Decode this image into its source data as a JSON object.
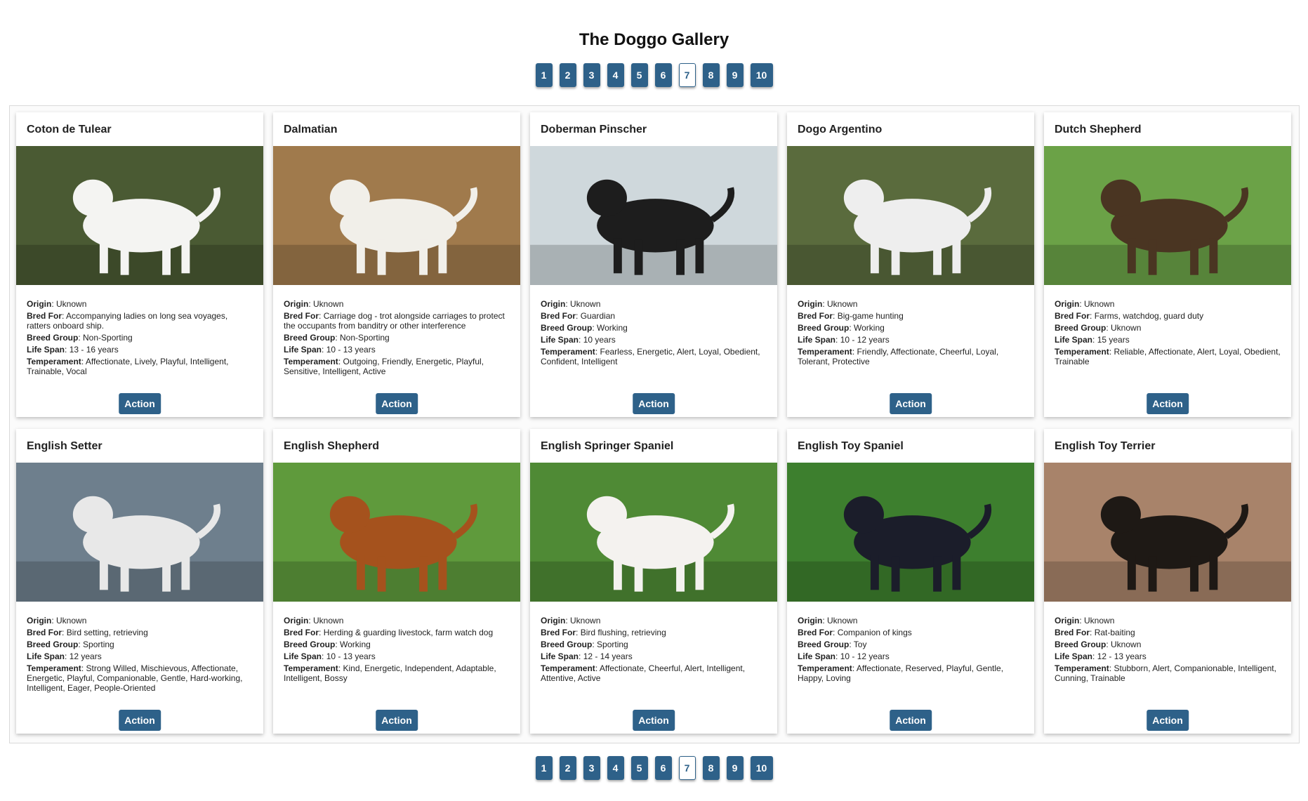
{
  "page": {
    "title": "The Doggo Gallery"
  },
  "pagination": {
    "pages": [
      "1",
      "2",
      "3",
      "4",
      "5",
      "6",
      "7",
      "8",
      "9",
      "10"
    ],
    "current": "7"
  },
  "labels": {
    "origin": "Origin",
    "bred_for": "Bred For",
    "breed_group": "Breed Group",
    "life_span": "Life Span",
    "temperament": "Temperament",
    "action": "Action"
  },
  "colors": {
    "accent": "#2e6189"
  },
  "breeds": [
    {
      "name": "Coton de Tulear",
      "origin": "Uknown",
      "bred_for": "Accompanying ladies on long sea voyages, ratters onboard ship.",
      "breed_group": "Non-Sporting",
      "life_span": "13 - 16 years",
      "temperament": "Affectionate, Lively, Playful, Intelligent, Trainable, Vocal",
      "photo": "white fluffy dog on garden path",
      "bg": "#4a5a33",
      "fg": "#f4f4f2"
    },
    {
      "name": "Dalmatian",
      "origin": "Uknown",
      "bred_for": "Carriage dog - trot alongside carriages to protect the occupants from banditry or other interference",
      "breed_group": "Non-Sporting",
      "life_span": "10 - 13 years",
      "temperament": "Outgoing, Friendly, Energetic, Playful, Sensitive, Intelligent, Active",
      "photo": "spotted dog in dry field",
      "bg": "#a07a4c",
      "fg": "#f1efe9"
    },
    {
      "name": "Doberman Pinscher",
      "origin": "Uknown",
      "bred_for": "Guardian",
      "breed_group": "Working",
      "life_span": "10 years",
      "temperament": "Fearless, Energetic, Alert, Loyal, Obedient, Confident, Intelligent",
      "photo": "black and tan dog running on beach",
      "bg": "#cfd8dc",
      "fg": "#1d1d1d"
    },
    {
      "name": "Dogo Argentino",
      "origin": "Uknown",
      "bred_for": "Big-game hunting",
      "breed_group": "Working",
      "life_span": "10 - 12 years",
      "temperament": "Friendly, Affectionate, Cheerful, Loyal, Tolerant, Protective",
      "photo": "white dog by palm plant",
      "bg": "#5a6b3d",
      "fg": "#eeeeee"
    },
    {
      "name": "Dutch Shepherd",
      "origin": "Uknown",
      "bred_for": "Farms, watchdog, guard duty",
      "breed_group": "Uknown",
      "life_span": "15 years",
      "temperament": "Reliable, Affectionate, Alert, Loyal, Obedient, Trainable",
      "photo": "brindle shepherd on grass",
      "bg": "#6ba247",
      "fg": "#4a3522"
    },
    {
      "name": "English Setter",
      "origin": "Uknown",
      "bred_for": "Bird setting, retrieving",
      "breed_group": "Sporting",
      "life_span": "12 years",
      "temperament": "Strong Willed, Mischievous, Affectionate, Energetic, Playful, Companionable, Gentle, Hard-working, Intelligent, Eager, People-Oriented",
      "photo": "speckled setter on rocky fjord",
      "bg": "#6e7f8d",
      "fg": "#e8e8e8"
    },
    {
      "name": "English Shepherd",
      "origin": "Uknown",
      "bred_for": "Herding & guarding livestock, farm watch dog",
      "breed_group": "Working",
      "life_span": "10 - 13 years",
      "temperament": "Kind, Energetic, Independent, Adaptable, Intelligent, Bossy",
      "photo": "red sable dog on grass",
      "bg": "#5f9a3c",
      "fg": "#a5521d"
    },
    {
      "name": "English Springer Spaniel",
      "origin": "Uknown",
      "bred_for": "Bird flushing, retrieving",
      "breed_group": "Sporting",
      "life_span": "12 - 14 years",
      "temperament": "Affectionate, Cheerful, Alert, Intelligent, Attentive, Active",
      "photo": "liver and white spaniel on grass",
      "bg": "#4f8a35",
      "fg": "#f4f2ef"
    },
    {
      "name": "English Toy Spaniel",
      "origin": "Uknown",
      "bred_for": "Companion of kings",
      "breed_group": "Toy",
      "life_span": "10 - 12 years",
      "temperament": "Affectionate, Reserved, Playful, Gentle, Happy, Loving",
      "photo": "black and tan long-haired dog",
      "bg": "#3d7f2e",
      "fg": "#1b1d2a"
    },
    {
      "name": "English Toy Terrier",
      "origin": "Uknown",
      "bred_for": "Rat-baiting",
      "breed_group": "Uknown",
      "life_span": "12 - 13 years",
      "temperament": "Stubborn, Alert, Companionable, Intelligent, Cunning, Trainable",
      "photo": "black and tan terrier by brick wall",
      "bg": "#a8836a",
      "fg": "#1e1915"
    }
  ]
}
